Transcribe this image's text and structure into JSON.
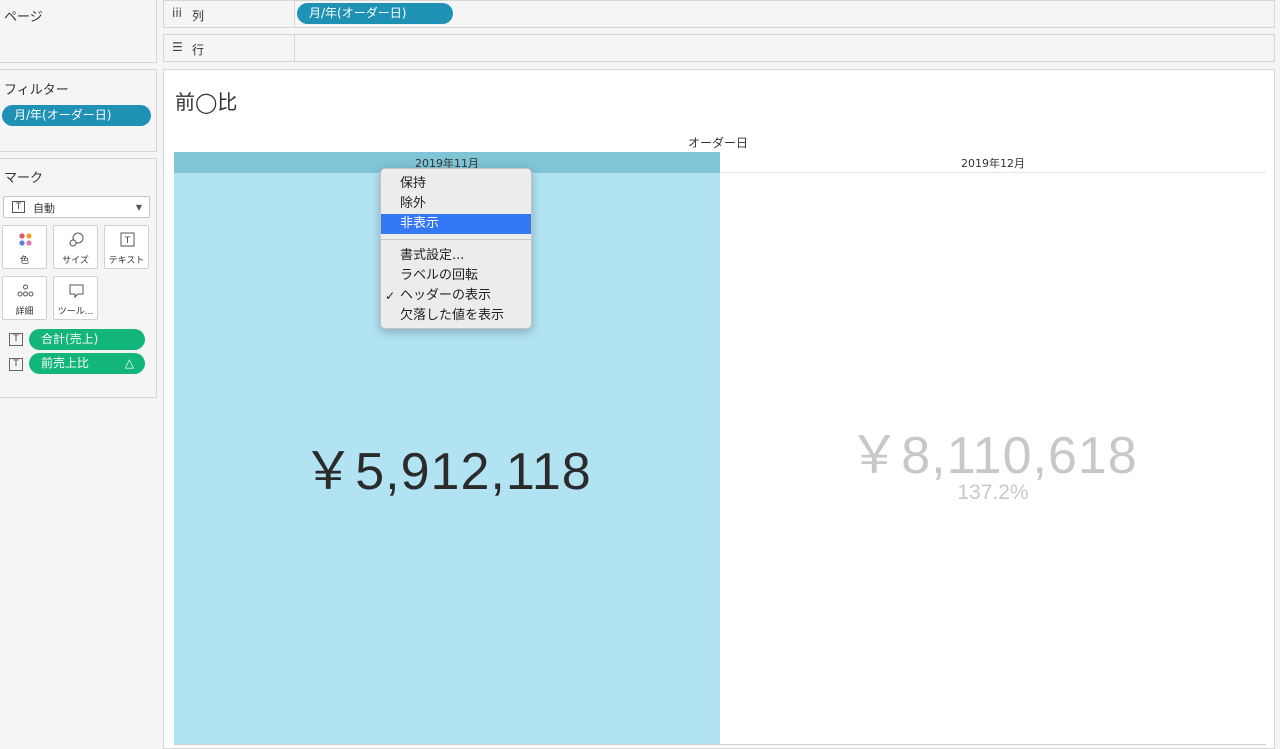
{
  "left_panel": {
    "pages_title": "ページ",
    "filters_title": "フィルター",
    "filter_pill": "月/年(オーダー日)",
    "marks_title": "マーク",
    "mark_type": "自動",
    "buttons": {
      "color": "色",
      "size": "サイズ",
      "text": "テキスト",
      "detail": "詳細",
      "tooltip": "ツール..."
    },
    "fields": [
      {
        "label": "合計(売上)"
      },
      {
        "label": "前売上比",
        "delta": "△"
      }
    ]
  },
  "shelves": {
    "columns_label": "列",
    "columns_pill": "月/年(オーダー日)",
    "rows_label": "行"
  },
  "view": {
    "title": "前◯比",
    "axis_title": "オーダー日",
    "columns": [
      {
        "header": "2019年11月",
        "value": "￥5,912,118"
      },
      {
        "header": "2019年12月",
        "value": "￥8,110,618",
        "pct": "137.2%"
      }
    ]
  },
  "context_menu": {
    "items": [
      "保持",
      "除外",
      "非表示",
      "書式設定...",
      "ラベルの回転",
      "ヘッダーの表示",
      "欠落した値を表示"
    ],
    "checked_item": "ヘッダーの表示",
    "highlighted_item": "非表示",
    "check_mark": "✓"
  },
  "colors": {
    "pill_blue": "#1f91b5",
    "pill_green": "#12b57a",
    "selected_cell": "#b1e3f2",
    "selected_header": "#7fc5d6",
    "menu_highlight": "#3478f6"
  }
}
